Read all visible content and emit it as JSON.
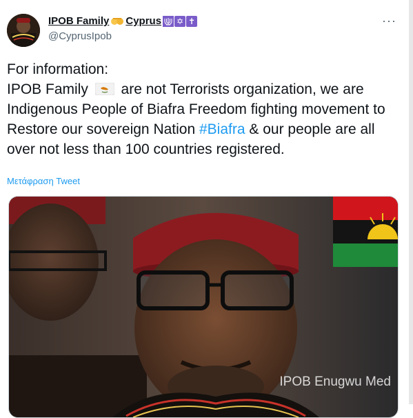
{
  "tweet": {
    "display_name": "IPOB Family",
    "name_suffix": "Cyprus",
    "handle": "@CyprusIpob",
    "more_label": "···",
    "text_line1": "For information:",
    "text_pre_flag": "IPOB Family",
    "text_after_flag": " are not Terrorists organization, we are Indigenous People of Biafra Freedom fighting movement to Restore our sovereign Nation ",
    "hashtag": "#Biafra",
    "text_tail": " & our people are all over not less than 100 countries registered.",
    "translate_label": "Μετάφραση Tweet",
    "image_watermark": "IPOB Enugwu Med",
    "name_symbols": [
      "✡",
      "✡",
      "✝"
    ]
  },
  "colors": {
    "link": "#1d9bf0",
    "text": "#0f1419",
    "secondary": "#536471",
    "symbol_bg": "#7a5cc9"
  }
}
